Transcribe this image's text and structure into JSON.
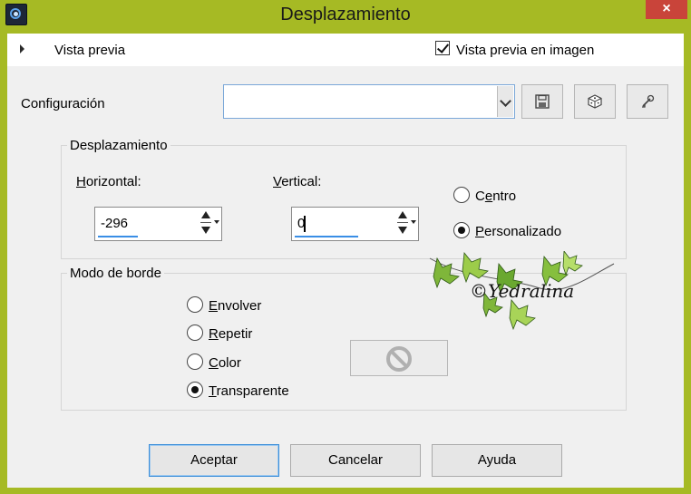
{
  "window": {
    "title": "Desplazamiento",
    "close_label": "×",
    "accent_color": "#a6ba24"
  },
  "preview": {
    "label": "Vista previa",
    "preview_in_image_label": "Vista previa en imagen",
    "preview_in_image_checked": true
  },
  "config": {
    "label": "Configuración",
    "selected_value": "",
    "tools": [
      "save-icon",
      "randomize-icon",
      "reset-icon"
    ]
  },
  "offset_group": {
    "title": "Desplazamiento",
    "horizontal": {
      "label_accel": "H",
      "label_rest": "orizontal:",
      "value": "-296"
    },
    "vertical": {
      "label_accel": "V",
      "label_rest": "ertical:",
      "value": "0"
    },
    "center": {
      "label_before": "C",
      "label_accel": "e",
      "label_rest": "ntro",
      "checked": false
    },
    "custom": {
      "label_accel": "P",
      "label_rest": "ersonalizado",
      "checked": true
    }
  },
  "border_group": {
    "title": "Modo de borde",
    "options": [
      {
        "accel": "E",
        "rest": "nvolver",
        "checked": false
      },
      {
        "accel": "R",
        "rest": "epetir",
        "checked": false
      },
      {
        "accel": "C",
        "rest": "olor",
        "checked": false
      },
      {
        "accel": "T",
        "rest": "ransparente",
        "checked": true
      }
    ],
    "color_swatch_icon": "disabled-icon"
  },
  "watermark": {
    "text": "©Yedralina"
  },
  "buttons": {
    "ok": "Aceptar",
    "cancel": "Cancelar",
    "help": "Ayuda"
  }
}
